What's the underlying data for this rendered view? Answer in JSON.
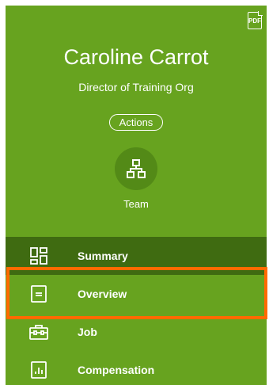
{
  "header": {
    "pdf_label": "PDF",
    "name": "Caroline Carrot",
    "job_title": "Director of Training Org",
    "actions_label": "Actions"
  },
  "team": {
    "label": "Team",
    "icon": "org-chart-icon"
  },
  "nav": {
    "items": [
      {
        "label": "Summary",
        "icon": "dashboard-icon"
      },
      {
        "label": "Overview",
        "icon": "document-icon"
      },
      {
        "label": "Job",
        "icon": "briefcase-icon"
      },
      {
        "label": "Compensation",
        "icon": "bar-chart-icon"
      }
    ]
  },
  "colors": {
    "panel": "#67a31f",
    "active_item": "#3f6b11",
    "highlight_border": "#ff6a00"
  }
}
